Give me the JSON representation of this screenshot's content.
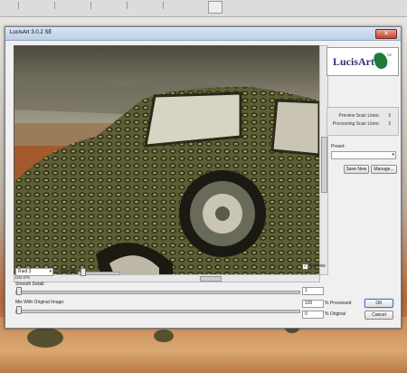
{
  "window": {
    "title": "LucisArt 3.0.2 SE",
    "close_glyph": "✕"
  },
  "preview": {
    "zoom": "100.0%"
  },
  "logo": {
    "text": "LucisArt",
    "edition": "SE"
  },
  "scan": {
    "preview_label": "Preview Scan Lines:",
    "preview_value": "3",
    "processing_label": "Processing Scan Lines:",
    "processing_value": "3"
  },
  "preset": {
    "label": "Preset:",
    "value": ""
  },
  "buttons": {
    "save_new": "Save New",
    "manage": "Manage...",
    "ok": "OK",
    "cancel": "Cancel"
  },
  "effect": {
    "mode": "Raid 3",
    "strength_label": "Strength:",
    "preview_label": "Preview",
    "preview_checked": true
  },
  "smooth": {
    "label": "Smooth Detail:",
    "value": "1"
  },
  "mix": {
    "label": "Mix With Original Image:",
    "processed_value": "100",
    "processed_label": "% Processed",
    "original_value": "0",
    "original_label": "% Original"
  },
  "icons": {
    "close": "close-icon",
    "dropdown": "chevron-down-icon",
    "check": "checkmark-icon"
  }
}
